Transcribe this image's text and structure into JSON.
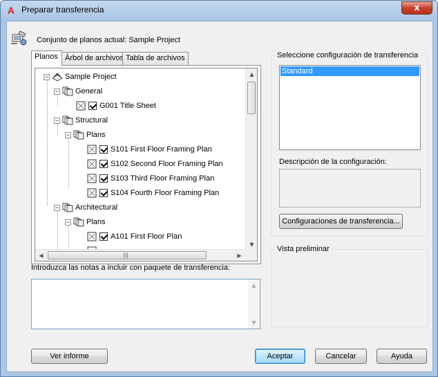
{
  "window": {
    "title": "Preparar transferencia",
    "app_icon_glyph": "A",
    "close_glyph": "x"
  },
  "header": {
    "current_set_text": "Conjunto de planos actual: Sample Project"
  },
  "tabs": [
    {
      "label": "Planos",
      "active": true
    },
    {
      "label": "Árbol de archivos",
      "active": false
    },
    {
      "label": "Tabla de archivos",
      "active": false
    }
  ],
  "tree": {
    "nodes": [
      {
        "label": "Sample Project",
        "type": "root"
      },
      {
        "label": "General",
        "type": "subset"
      },
      {
        "label": "G001 Title Sheet",
        "type": "sheet",
        "checked": true
      },
      {
        "label": "Structural",
        "type": "subset"
      },
      {
        "label": "Plans",
        "type": "subset"
      },
      {
        "label": "S101 First Floor Framing Plan",
        "type": "sheet",
        "checked": true
      },
      {
        "label": "S102 Second Floor Framing Plan",
        "type": "sheet",
        "checked": true
      },
      {
        "label": "S103 Third Floor Framing Plan",
        "type": "sheet",
        "checked": true
      },
      {
        "label": "S104 Fourth Floor Framing Plan",
        "type": "sheet",
        "checked": true
      },
      {
        "label": "Architectural",
        "type": "subset"
      },
      {
        "label": "Plans",
        "type": "subset"
      },
      {
        "label": "A101 First Floor Plan",
        "type": "sheet",
        "checked": true
      }
    ],
    "expander_glyph": "−"
  },
  "notes": {
    "label": "Introduzca las notas a incluir con paquete de transferencia:",
    "value": ""
  },
  "transfer_config": {
    "group_title": "Seleccione configuración de transferencia",
    "items": [
      "Standard"
    ],
    "selected": "Standard",
    "description_label": "Descripción de la configuración:",
    "description_value": "",
    "configs_button": "Configuraciones de transferencia..."
  },
  "preview": {
    "group_title": "Vista preliminar"
  },
  "buttons": {
    "report": "Ver informe",
    "ok": "Aceptar",
    "cancel": "Cancelar",
    "help": "Ayuda"
  },
  "colors": {
    "selection": "#3399ff",
    "titlebar": "#aac6e4",
    "close_button": "#c7432c"
  }
}
